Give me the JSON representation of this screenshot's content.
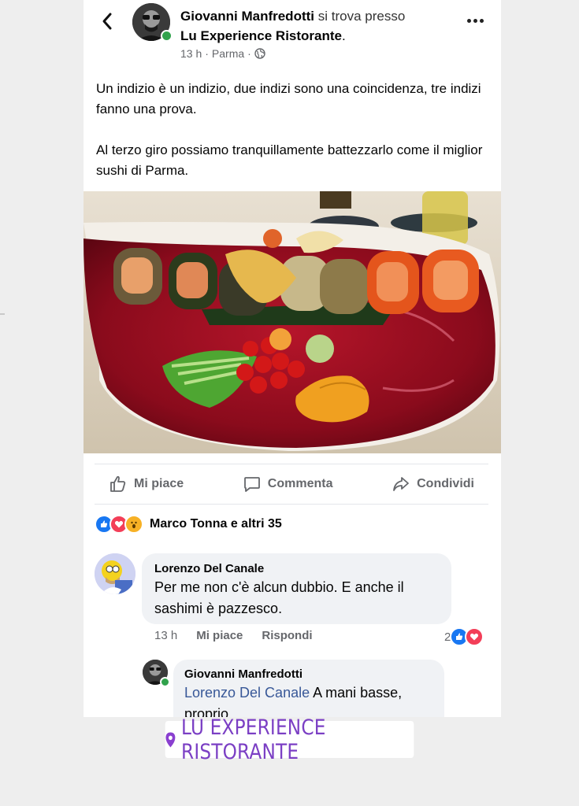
{
  "post": {
    "author": "Giovanni Manfredotti",
    "with_text": "si trova presso",
    "place": "Lu Experience Ristorante",
    "place_suffix": ".",
    "time": "13 h",
    "location": "Parma",
    "separator": "·",
    "paragraph1": "Un indizio è un indizio, due indizi sono una coincidenza, tre indizi fanno una prova.",
    "paragraph2": "Al terzo giro possiamo tranquillamente battezzarlo come il miglior sushi di Parma."
  },
  "actions": {
    "like": "Mi piace",
    "comment": "Commenta",
    "share": "Condividi"
  },
  "reactions": {
    "summary": "Marco Tonna e altri 35",
    "types": [
      "like-icon",
      "love-icon",
      "wow-icon"
    ]
  },
  "comments": [
    {
      "author": "Lorenzo Del Canale",
      "text": "Per me non c'è alcun dubbio. E anche il sashimi è pazzesco.",
      "time": "13 h",
      "like": "Mi piace",
      "reply": "Rispondi",
      "reaction_count": "2"
    },
    {
      "author": "Giovanni Manfredotti",
      "mention": "Lorenzo Del Canale",
      "text": "A mani basse, proprio."
    }
  ],
  "sticker": {
    "location": "LU EXPERIENCE RISTORANTE"
  },
  "colors": {
    "accent_blue": "#1877f2",
    "love_red": "#f33e58",
    "online_green": "#31a24c",
    "sticker_purple": "#7b3fc4",
    "mention_blue": "#385898"
  }
}
